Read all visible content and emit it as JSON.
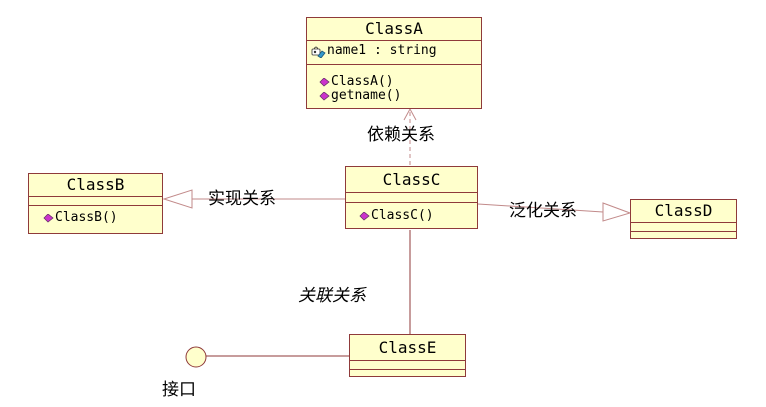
{
  "classes": {
    "a": {
      "name": "ClassA",
      "attributes": [
        "name1 : string"
      ],
      "operations": [
        "ClassA()",
        "getname()"
      ]
    },
    "b": {
      "name": "ClassB",
      "operations": [
        "ClassB()"
      ]
    },
    "c": {
      "name": "ClassC",
      "operations": [
        "ClassC()"
      ]
    },
    "d": {
      "name": "ClassD"
    },
    "e": {
      "name": "ClassE"
    }
  },
  "labels": {
    "dependency": "依赖关系",
    "realization": "实现关系",
    "generalization": "泛化关系",
    "association": "关联关系",
    "interface": "接口"
  },
  "colors": {
    "class_fill": "#ffffcc",
    "class_border": "#8f3a3a",
    "line": "#8f3a3a",
    "operation_icon": "#cc33cc",
    "attribute_icon": "#3399cc"
  },
  "icons": {
    "operation": "operation-diamond-icon",
    "attribute": "attribute-key-icon"
  }
}
